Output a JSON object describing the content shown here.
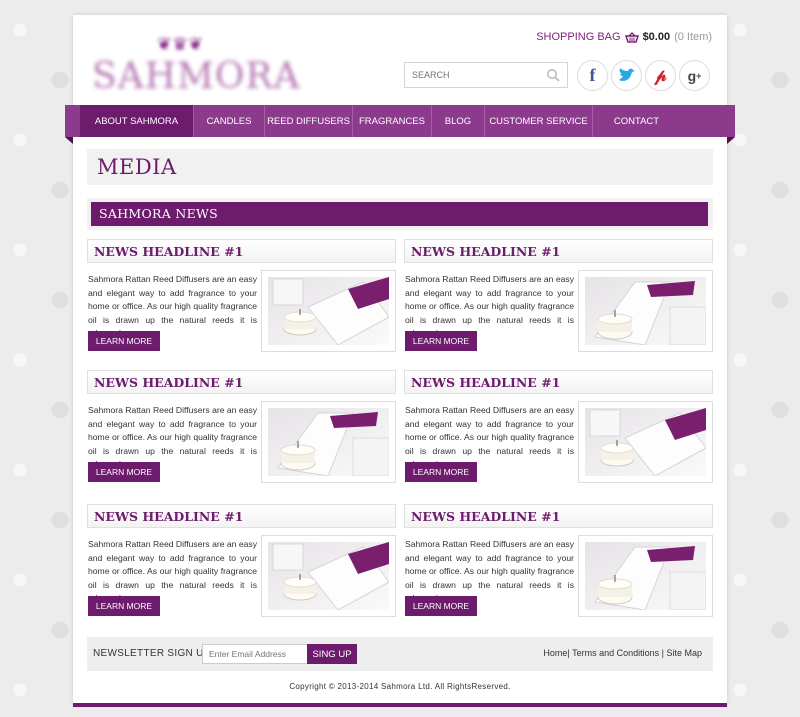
{
  "brand": {
    "logo_text": "SAHMORA",
    "accent": "#6d1b6c"
  },
  "header": {
    "bag_label": "SHOPPING BAG",
    "bag_amount": "$0.00",
    "bag_items": "(0 Item)",
    "search_placeholder": "SEARCH",
    "social": [
      {
        "icon": "facebook-icon",
        "glyph": "f",
        "color": "#3b5998"
      },
      {
        "icon": "twitter-icon",
        "glyph": "t",
        "color": "#1da1f2"
      },
      {
        "icon": "pinterest-icon",
        "glyph": "P",
        "color": "#cb2027"
      },
      {
        "icon": "googleplus-icon",
        "glyph": "g+",
        "color": "#444444"
      }
    ]
  },
  "nav": {
    "items": [
      "ABOUT SAHMORA",
      "CANDLES",
      "REED DIFFUSERS",
      "FRAGRANCES",
      "BLOG",
      "CUSTOMER SERVICE",
      "CONTACT"
    ]
  },
  "main": {
    "page_title": "MEDIA",
    "section_title": "SAHMORA NEWS",
    "cards": [
      {
        "headline": "NEWS HEADLINE #1",
        "text": "Sahmora Rattan Reed Diffusers are an easy and elegant way to add fragrance to your home or office. As our high quality fragrance oil is drawn up the natural reeds it is released....",
        "button": "LEARN MORE"
      },
      {
        "headline": "NEWS HEADLINE #1",
        "text": "Sahmora Rattan Reed Diffusers are an easy and elegant way to add fragrance to your home or office. As our high quality fragrance oil is drawn up the natural reeds it is released....",
        "button": "LEARN MORE"
      },
      {
        "headline": "NEWS HEADLINE #1",
        "text": "Sahmora Rattan Reed Diffusers are an easy and elegant way to add fragrance to your home or office. As our high quality fragrance oil is drawn up the natural reeds it is released....",
        "button": "LEARN MORE"
      },
      {
        "headline": "NEWS HEADLINE #1",
        "text": "Sahmora Rattan Reed Diffusers are an easy and elegant way to add fragrance to your home or office. As our high quality fragrance oil is drawn up the natural reeds it is released....",
        "button": "LEARN MORE"
      },
      {
        "headline": "NEWS HEADLINE #1",
        "text": "Sahmora Rattan Reed Diffusers are an easy and elegant way to add fragrance to your home or office. As our high quality fragrance oil is drawn up the natural reeds it is released....",
        "button": "LEARN MORE"
      },
      {
        "headline": "NEWS HEADLINE #1",
        "text": "Sahmora Rattan Reed Diffusers are an easy and elegant way to add fragrance to your home or office. As our high quality fragrance oil is drawn up the natural reeds it is released....",
        "button": "LEARN MORE"
      }
    ]
  },
  "footer": {
    "newsletter_label": "NEWSLETTER SIGN UP",
    "email_placeholder": "Enter Email Address",
    "signup_button": "SING UP",
    "links": [
      "Home",
      "Terms and Conditions",
      "Site Map"
    ],
    "copyright": "Copyright © 2013-2014 Sahmora Ltd. All RightsReserved."
  }
}
